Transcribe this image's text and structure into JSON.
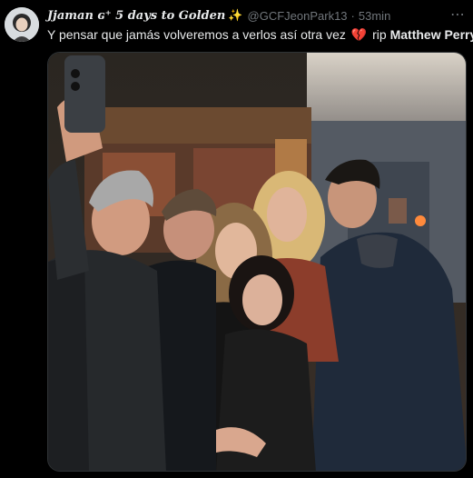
{
  "author": {
    "display_name": "Jjaman ɢ⁺ 5 days to Golden",
    "verified_emoji": "✨",
    "handle": "@GCFJeonPark13",
    "separator": "·",
    "time": "53min"
  },
  "more_icon": "⋯",
  "tweet": {
    "text_before": "Y pensar que jamás volveremos a verlos así otra vez",
    "broken_heart": "💔",
    "rip": "rip",
    "name": "Matthew Perry"
  },
  "media": {
    "description_icon": "photo-image"
  },
  "colors": {
    "background": "#000000",
    "text": "#e7e9ea",
    "muted": "#71767b",
    "accent_heart": "#e0245e"
  }
}
